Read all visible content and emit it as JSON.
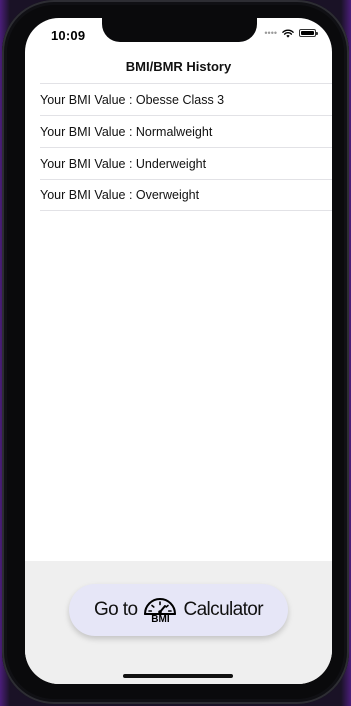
{
  "status_bar": {
    "time": "10:09"
  },
  "nav": {
    "title": "BMI/BMR History"
  },
  "history": [
    {
      "text": "Your BMI Value : Obesse Class 3"
    },
    {
      "text": "Your BMI Value : Normalweight"
    },
    {
      "text": "Your BMI Value : Underweight"
    },
    {
      "text": "Your BMI Value : Overweight"
    }
  ],
  "footer": {
    "button_prefix": "Go to",
    "button_icon_label": "BMI",
    "button_suffix": "Calculator"
  },
  "colors": {
    "button_bg": "#e6e6f7",
    "footer_bg": "#efefef",
    "screen_bg": "#ffffff"
  },
  "icons": {
    "button_icon": "speedometer-icon",
    "signal": "cellular-signal-icon",
    "wifi": "wifi-icon",
    "battery": "battery-icon"
  }
}
